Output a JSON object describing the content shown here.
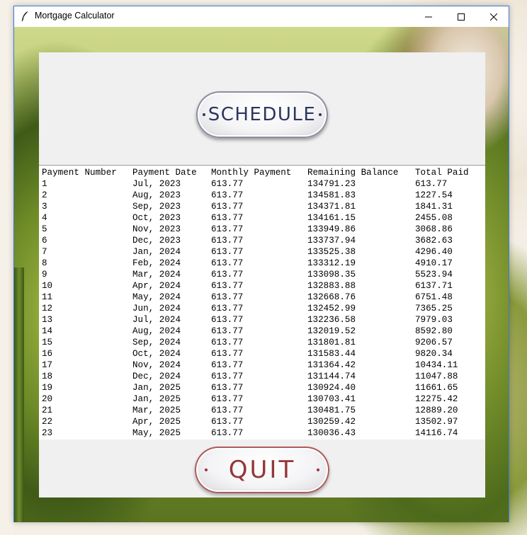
{
  "window": {
    "title": "Mortgage Calculator",
    "icon": "feather-icon",
    "controls": [
      "minimize-icon",
      "maximize-icon",
      "close-icon"
    ]
  },
  "buttons": {
    "schedule_label": "SCHEDULE",
    "quit_label": "QUIT"
  },
  "colors": {
    "schedule_text": "#2d3560",
    "quit_text": "#963538",
    "panel_bg": "#f0f0f0"
  },
  "schedule_table": {
    "headers": [
      "Payment Number",
      "Payment Date",
      "Monthly Payment",
      "Remaining Balance",
      "Total Paid"
    ],
    "rows": [
      [
        "1",
        "Jul, 2023",
        "613.77",
        "134791.23",
        "613.77"
      ],
      [
        "2",
        "Aug, 2023",
        "613.77",
        "134581.83",
        "1227.54"
      ],
      [
        "3",
        "Sep, 2023",
        "613.77",
        "134371.81",
        "1841.31"
      ],
      [
        "4",
        "Oct, 2023",
        "613.77",
        "134161.15",
        "2455.08"
      ],
      [
        "5",
        "Nov, 2023",
        "613.77",
        "133949.86",
        "3068.86"
      ],
      [
        "6",
        "Dec, 2023",
        "613.77",
        "133737.94",
        "3682.63"
      ],
      [
        "7",
        "Jan, 2024",
        "613.77",
        "133525.38",
        "4296.40"
      ],
      [
        "8",
        "Feb, 2024",
        "613.77",
        "133312.19",
        "4910.17"
      ],
      [
        "9",
        "Mar, 2024",
        "613.77",
        "133098.35",
        "5523.94"
      ],
      [
        "10",
        "Apr, 2024",
        "613.77",
        "132883.88",
        "6137.71"
      ],
      [
        "11",
        "May, 2024",
        "613.77",
        "132668.76",
        "6751.48"
      ],
      [
        "12",
        "Jun, 2024",
        "613.77",
        "132452.99",
        "7365.25"
      ],
      [
        "13",
        "Jul, 2024",
        "613.77",
        "132236.58",
        "7979.03"
      ],
      [
        "14",
        "Aug, 2024",
        "613.77",
        "132019.52",
        "8592.80"
      ],
      [
        "15",
        "Sep, 2024",
        "613.77",
        "131801.81",
        "9206.57"
      ],
      [
        "16",
        "Oct, 2024",
        "613.77",
        "131583.44",
        "9820.34"
      ],
      [
        "17",
        "Nov, 2024",
        "613.77",
        "131364.42",
        "10434.11"
      ],
      [
        "18",
        "Dec, 2024",
        "613.77",
        "131144.74",
        "11047.88"
      ],
      [
        "19",
        "Jan, 2025",
        "613.77",
        "130924.40",
        "11661.65"
      ],
      [
        "20",
        "Jan, 2025",
        "613.77",
        "130703.41",
        "12275.42"
      ],
      [
        "21",
        "Mar, 2025",
        "613.77",
        "130481.75",
        "12889.20"
      ],
      [
        "22",
        "Apr, 2025",
        "613.77",
        "130259.42",
        "13502.97"
      ],
      [
        "23",
        "May, 2025",
        "613.77",
        "130036.43",
        "14116.74"
      ]
    ]
  }
}
